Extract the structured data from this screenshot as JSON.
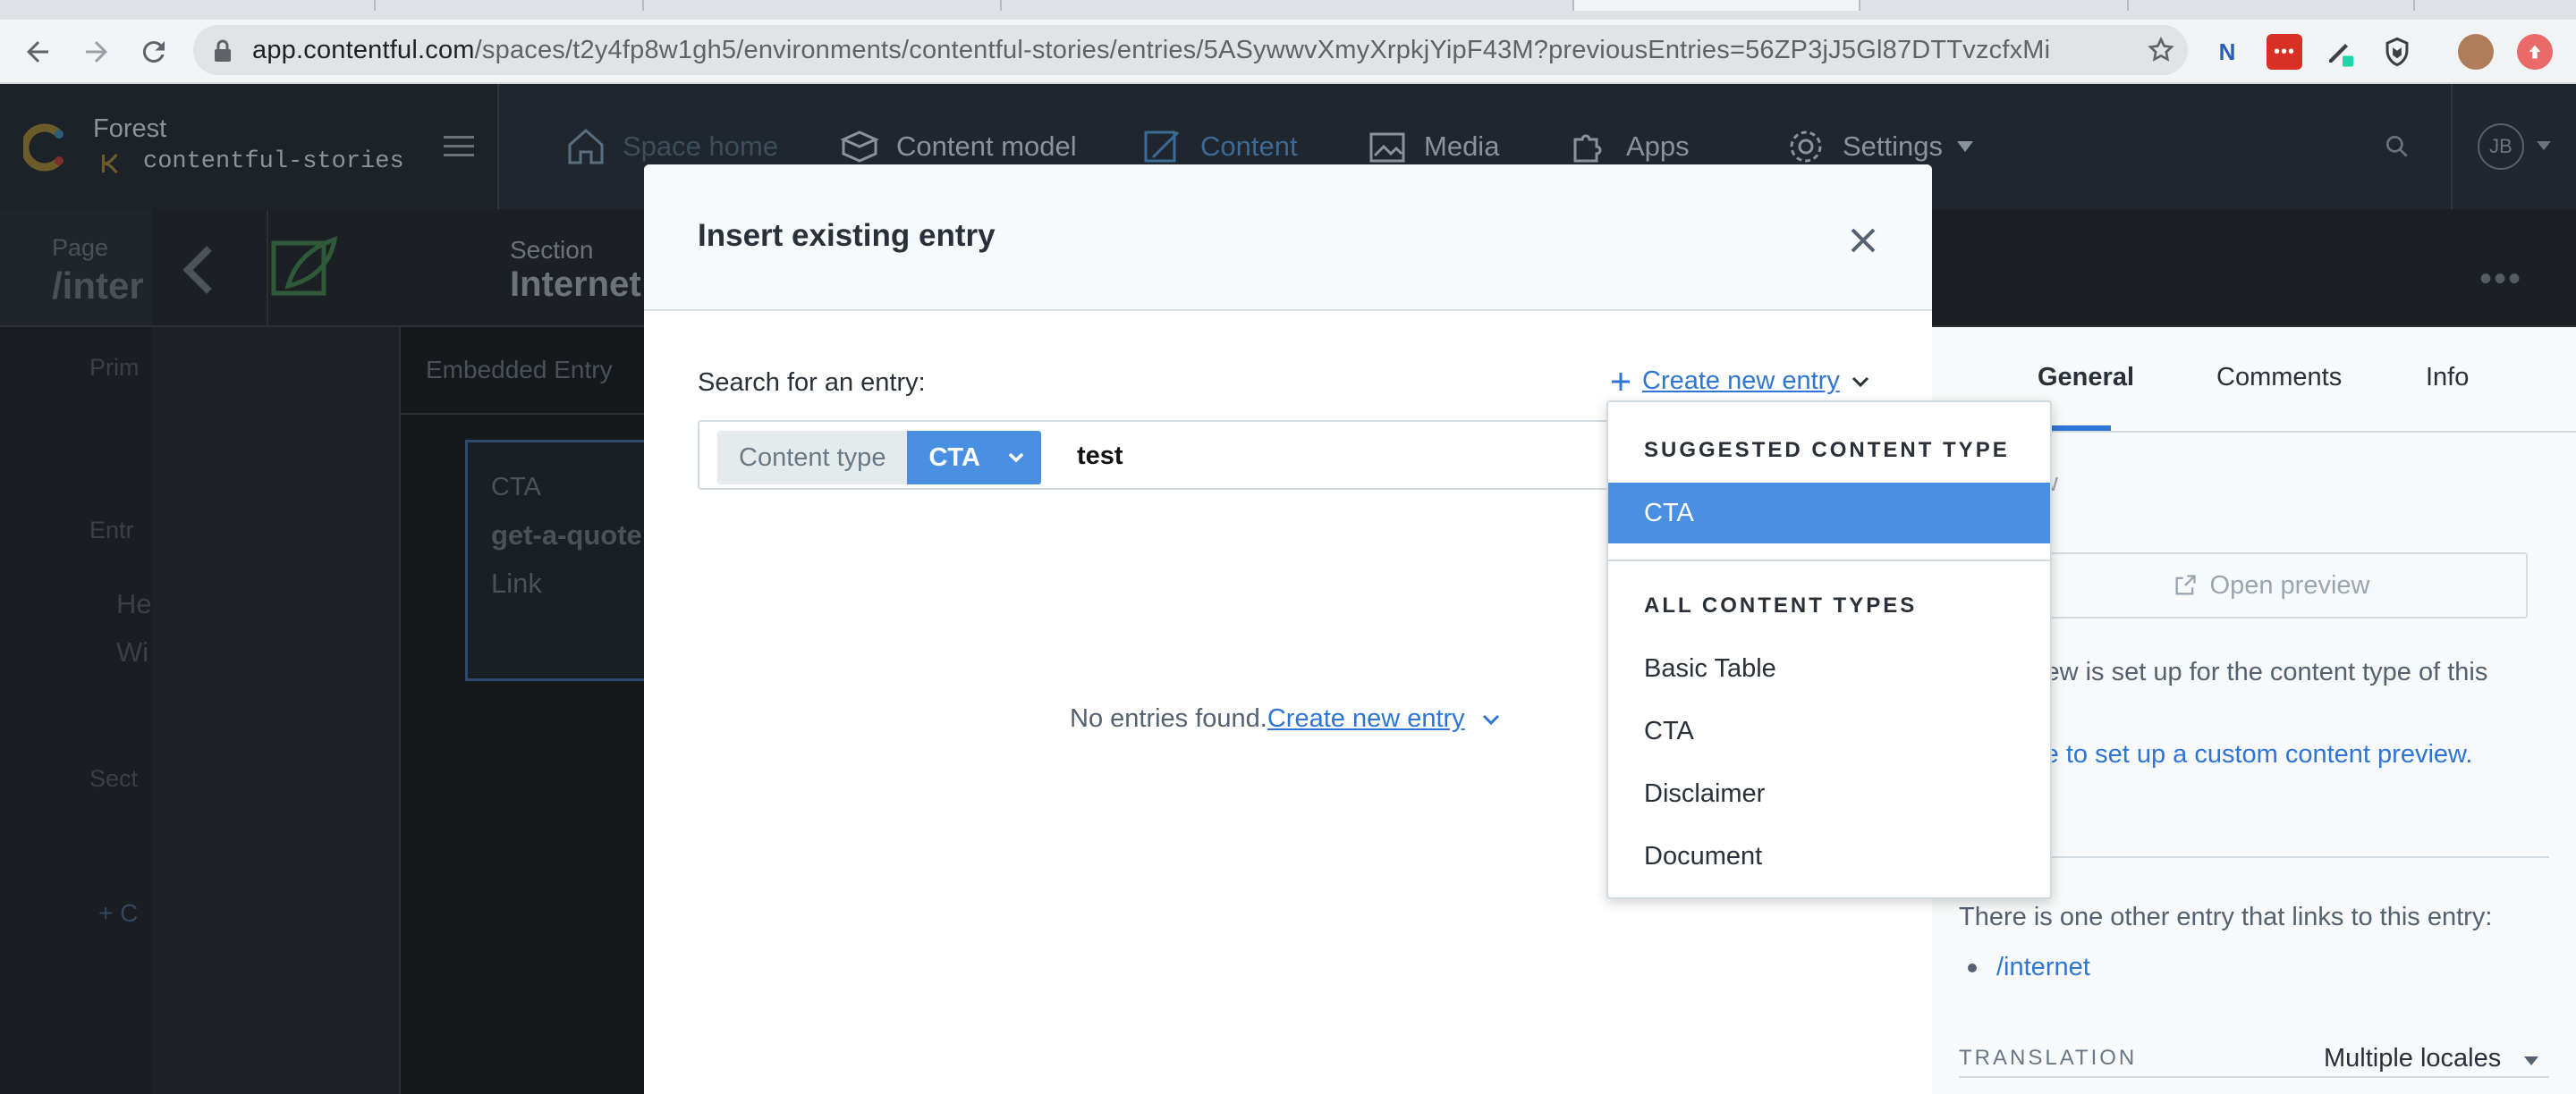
{
  "browser": {
    "url_host": "app.contentful.com",
    "url_path": "/spaces/t2y4fp8w1gh5/environments/contentful-stories/entries/5ASywwvXmyXrpkjYipF43M?previousEntries=56ZP3jJ5Gl87DTTvzcfxMi"
  },
  "app_nav": {
    "space_name": "Forest",
    "environment": "contentful-stories",
    "items": [
      "Space home",
      "Content model",
      "Content",
      "Media",
      "Apps",
      "Settings"
    ],
    "active_item": "Content",
    "avatar_initials": "JB"
  },
  "background_page": {
    "page_label": "Page",
    "page_title": "/inter",
    "section_label": "Section",
    "section_title": "Internet Partners",
    "field_label": "Embedded Entry",
    "card_type": "CTA",
    "card_title": "get-a-quote",
    "card_subtitle": "Link",
    "left_fragments": [
      "Prim",
      "Entr",
      "He",
      "Wi",
      "Sect",
      "+ C"
    ]
  },
  "modal": {
    "title": "Insert existing entry",
    "search_label": "Search for an entry:",
    "create_new_label": "Create new entry",
    "content_type_label": "Content type",
    "content_type_value": "CTA",
    "search_value": "test",
    "no_entries_text": "No entries found.",
    "no_entries_link": "Create new entry"
  },
  "dropdown": {
    "suggested_heading": "SUGGESTED CONTENT TYPE",
    "suggested_item": "CTA",
    "all_heading": "ALL CONTENT TYPES",
    "all_items": [
      "Basic Table",
      "CTA",
      "Disclaimer",
      "Document"
    ]
  },
  "sidebar": {
    "tabs": [
      "General",
      "Comments",
      "Info"
    ],
    "active_tab": "General",
    "preview_fragment": "w",
    "open_preview": "Open preview",
    "preview_note": "iew is set up for the content type of this",
    "preview_link": "re to set up a custom content preview.",
    "links_text": "There is one other entry that links to this entry:",
    "linked_entry": "/internet",
    "translation_label": "TRANSLATION",
    "translation_value": "Multiple locales"
  },
  "colors": {
    "primary_blue": "#4a90e2",
    "link_blue": "#2e75d4",
    "overlay": "#1a1d21"
  }
}
